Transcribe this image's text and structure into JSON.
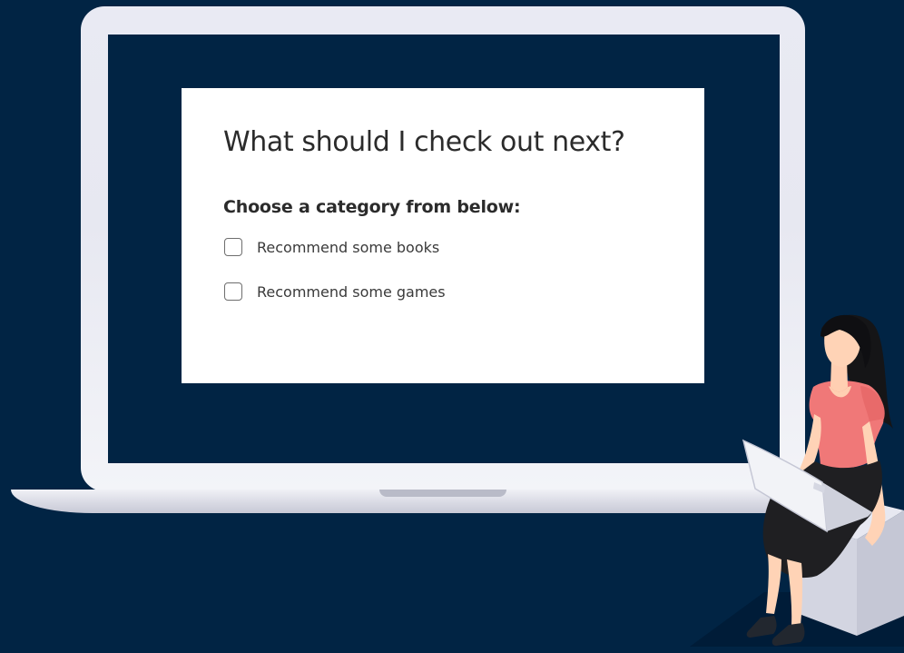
{
  "form": {
    "title": "What should I check out next?",
    "subtitle": "Choose a category from below:",
    "options": [
      {
        "label": "Recommend some books",
        "checked": false
      },
      {
        "label": "Recommend some games",
        "checked": false
      }
    ]
  },
  "colors": {
    "background": "#012444",
    "card": "#ffffff",
    "laptop_frame": "#e9eaf3",
    "shirt": "#f07878",
    "skirt": "#1f1f22"
  },
  "icons": [
    "checkbox-icon",
    "laptop-frame",
    "person-with-laptop-illustration"
  ]
}
